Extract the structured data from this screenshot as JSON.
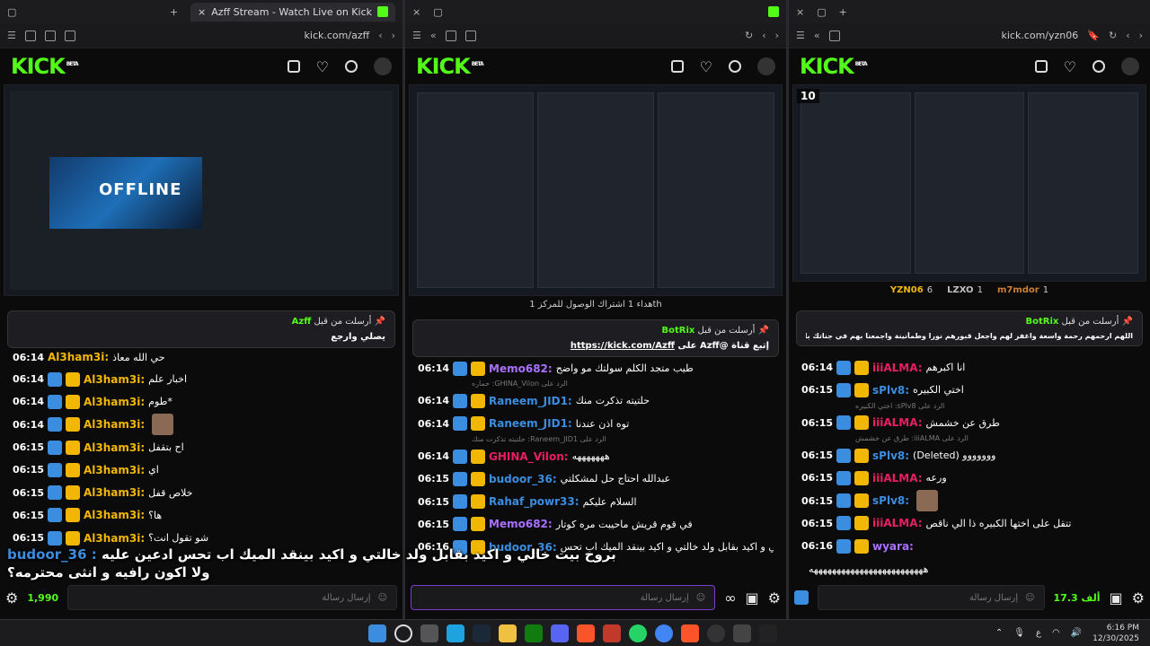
{
  "windows": [
    {
      "tab_title": "Azff Stream - Watch Live on Kick",
      "url": "kick.com/azff",
      "logo": "KICK",
      "logo_sup": "BETA",
      "pinned": {
        "title": "أرسلت من قبل",
        "user": "Azff",
        "text": "يصلي وارجع"
      },
      "messages": [
        {
          "time": "06:14",
          "user": "Al3ham3i:",
          "text": "اخبار علم",
          "color": "#f2b705"
        },
        {
          "time": "06:14",
          "user": "Al3ham3i:",
          "text": "طوم*",
          "color": "#f2b705"
        },
        {
          "time": "06:14",
          "user": "Al3ham3i:",
          "text": "",
          "color": "#f2b705",
          "emote": true
        },
        {
          "time": "06:15",
          "user": "Al3ham3i:",
          "text": "اح بتقفل",
          "color": "#f2b705"
        },
        {
          "time": "06:15",
          "user": "Al3ham3i:",
          "text": "اي",
          "color": "#f2b705"
        },
        {
          "time": "06:15",
          "user": "Al3ham3i:",
          "text": "خلاص قفل",
          "color": "#f2b705"
        },
        {
          "time": "06:15",
          "user": "Al3ham3i:",
          "text": "ها؟",
          "color": "#f2b705"
        },
        {
          "time": "06:15",
          "user": "Al3ham3i:",
          "text": "شو تقول انت؟",
          "color": "#f2b705"
        }
      ],
      "first_row": {
        "time": "06:14",
        "user": "Al3ham3i:",
        "text": "حي الله معاذ"
      },
      "input_placeholder": "إرسال رسالة",
      "points": "1,990"
    },
    {
      "url": "",
      "announce": "هداء 1 اشتراك الوصول للمركز 1th",
      "pinned": {
        "title": "أرسلت من قبل",
        "user": "BotRix",
        "text_a": "@Azff على",
        "text_link": "https://kick.com/Azff",
        "text_b": "إتبع قناة"
      },
      "messages": [
        {
          "time": "06:14",
          "user": "Memo682:",
          "text": "طيب متجد الكلم سولتك مو واضح",
          "color": "#a970ff"
        },
        {
          "type": "reply",
          "text": "الرد على GHINA_Vilon: حماره"
        },
        {
          "time": "06:14",
          "user": "Raneem_JID1:",
          "text": "حلتيته تذكرت منك",
          "color": "#3b8de0"
        },
        {
          "time": "06:14",
          "user": "Raneem_JID1:",
          "text": "توه اذن عندنا",
          "color": "#3b8de0"
        },
        {
          "type": "reply",
          "text": "الرد على Raneem_JID1: حلتيته تذكرت منك"
        },
        {
          "time": "06:14",
          "user": "GHINA_Vilon:",
          "text": "هههههههه",
          "color": "#e91e63"
        },
        {
          "time": "06:15",
          "user": "budoor_36:",
          "text": "عبدالله احتاج حل لمشكلتي",
          "color": "#3b8de0"
        },
        {
          "time": "06:15",
          "user": "Rahaf_powr33:",
          "text": "السلام عليكم",
          "color": "#3b8de0"
        },
        {
          "time": "06:15",
          "user": "Memo682:",
          "text": "في قوم قريش ماحيبت مره كوتار",
          "color": "#a970ff"
        },
        {
          "time": "06:16",
          "user": "budoor_36:",
          "text": "بروح بيت خالي و اكيد بقابل ولد خالتي و اكيد بينقد الميك اب تحس",
          "color": "#3b8de0"
        }
      ],
      "input_placeholder": "إرسال رسالة"
    },
    {
      "url": "kick.com/yzn06",
      "viewers": "10",
      "top_users": [
        {
          "name": "YZN06",
          "count": "6",
          "color": "#f2b705"
        },
        {
          "name": "LZXO",
          "count": "1",
          "color": "#c0c0c0"
        },
        {
          "name": "m7mdor",
          "count": "1",
          "color": "#cd7f32"
        }
      ],
      "pinned": {
        "title": "أرسلت من قبل",
        "user": "BotRix",
        "text": "اللهم ارحمهم رحمة واسعة واغفر لهم واجعل قبورهم نورا وطمأنينة واجمعنا بهم في جناتك بلا حساب ولا عذاب"
      },
      "messages": [
        {
          "time": "06:14",
          "user": "iiiALMA:",
          "text": "انا اكبرهم",
          "color": "#e91e63"
        },
        {
          "time": "06:15",
          "user": "sPlv8:",
          "text": "اختي الكبيره",
          "color": "#3b8de0"
        },
        {
          "type": "reply",
          "text": "الرد على sPlv8: اختي الكبيره"
        },
        {
          "time": "06:15",
          "user": "iiiALMA:",
          "text": "طرق عن خشمش",
          "color": "#e91e63"
        },
        {
          "type": "reply",
          "text": "الرد على iiiALMA: طرق عن خشمش"
        },
        {
          "time": "06:15",
          "user": "sPlv8:",
          "text": "(Deleted) ووووووو",
          "color": "#3b8de0"
        },
        {
          "time": "06:15",
          "user": "iiiALMA:",
          "text": "ورعه",
          "color": "#e91e63"
        },
        {
          "time": "06:15",
          "user": "sPlv8:",
          "text": "",
          "color": "#3b8de0",
          "emote": true
        },
        {
          "time": "06:15",
          "user": "iiiALMA:",
          "text": "تتقل على اختها الكبيره ذا الي ناقص",
          "color": "#e91e63"
        },
        {
          "time": "06:16",
          "user": "wyara:",
          "text": "",
          "color": "#a970ff"
        },
        {
          "time": "",
          "user": "",
          "text": "هههههههههههههههههههههههههه",
          "color": "#fff"
        }
      ],
      "input_placeholder": "إرسال رسالة",
      "points": "17.3 ألف"
    }
  ],
  "overlay": {
    "name": "budoor_36 :",
    "line1": "بروح بيت خالي و اكيد بقابل ولد خالتي و اكيد بينقد الميك اب تحس ادعين عليه",
    "line2": "ولا اكون رافيه و انثى محترمه؟"
  },
  "taskbar": {
    "lang": "ع",
    "time": "6:16 PM",
    "date": "12/30/2025"
  }
}
